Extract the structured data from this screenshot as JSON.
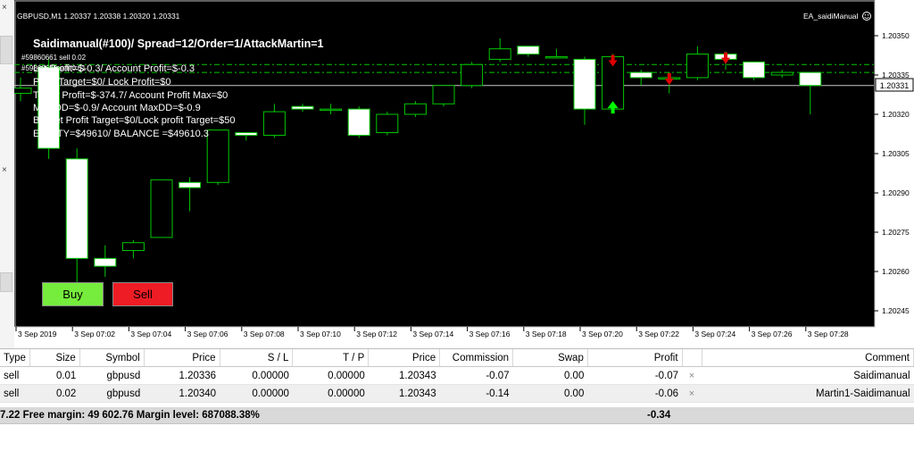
{
  "chart": {
    "header": "GBPUSD,M1  1.20337 1.20338 1.20320 1.20331",
    "ea_name": "EA_saidiManual",
    "ea_icon": "smiley-icon",
    "current_price": "1.20331",
    "price_axis": [
      "1.20350",
      "1.20335",
      "1.20320",
      "1.20305",
      "1.20290",
      "1.20275",
      "1.20260",
      "1.20245"
    ],
    "time_axis": [
      "3 Sep 2019",
      "3 Sep 07:02",
      "3 Sep 07:04",
      "3 Sep 07:06",
      "3 Sep 07:08",
      "3 Sep 07:10",
      "3 Sep 07:12",
      "3 Sep 07:14",
      "3 Sep 07:16",
      "3 Sep 07:18",
      "3 Sep 07:20",
      "3 Sep 07:22",
      "3 Sep 07:24",
      "3 Sep 07:26",
      "3 Sep 07:28"
    ],
    "colors": {
      "background": "#000000",
      "bull": "#00c800",
      "bear": "#ffffff",
      "grid_line": "#00c800",
      "buy_arrow": "#00ff00",
      "sell_arrow": "#e00000"
    },
    "candles": [
      {
        "o": 1.20328,
        "h": 1.20334,
        "l": 1.20325,
        "c": 1.2033
      },
      {
        "o": 1.20338,
        "h": 1.20341,
        "l": 1.20303,
        "c": 1.20307
      },
      {
        "o": 1.20303,
        "h": 1.20307,
        "l": 1.20255,
        "c": 1.20265
      },
      {
        "o": 1.20265,
        "h": 1.2027,
        "l": 1.20258,
        "c": 1.20262
      },
      {
        "o": 1.20268,
        "h": 1.20272,
        "l": 1.20265,
        "c": 1.20271
      },
      {
        "o": 1.20273,
        "h": 1.20295,
        "l": 1.20273,
        "c": 1.20295
      },
      {
        "o": 1.20294,
        "h": 1.20296,
        "l": 1.20283,
        "c": 1.20292
      },
      {
        "o": 1.20294,
        "h": 1.20314,
        "l": 1.20293,
        "c": 1.20314
      },
      {
        "o": 1.20313,
        "h": 1.20313,
        "l": 1.2031,
        "c": 1.20312
      },
      {
        "o": 1.20312,
        "h": 1.20324,
        "l": 1.20311,
        "c": 1.20321
      },
      {
        "o": 1.20323,
        "h": 1.20324,
        "l": 1.20321,
        "c": 1.20322
      },
      {
        "o": 1.20322,
        "h": 1.20324,
        "l": 1.2032,
        "c": 1.20322
      },
      {
        "o": 1.20322,
        "h": 1.20323,
        "l": 1.20311,
        "c": 1.20312
      },
      {
        "o": 1.20313,
        "h": 1.20321,
        "l": 1.20312,
        "c": 1.2032
      },
      {
        "o": 1.2032,
        "h": 1.20325,
        "l": 1.20319,
        "c": 1.20324
      },
      {
        "o": 1.20324,
        "h": 1.20331,
        "l": 1.20323,
        "c": 1.20331
      },
      {
        "o": 1.20331,
        "h": 1.2034,
        "l": 1.2033,
        "c": 1.20339
      },
      {
        "o": 1.20341,
        "h": 1.20349,
        "l": 1.2034,
        "c": 1.20345
      },
      {
        "o": 1.20346,
        "h": 1.20346,
        "l": 1.20342,
        "c": 1.20343
      },
      {
        "o": 1.20342,
        "h": 1.20345,
        "l": 1.20342,
        "c": 1.20342
      },
      {
        "o": 1.20341,
        "h": 1.20342,
        "l": 1.20316,
        "c": 1.20322
      },
      {
        "o": 1.20322,
        "h": 1.20343,
        "l": 1.20321,
        "c": 1.20342
      },
      {
        "o": 1.20336,
        "h": 1.20337,
        "l": 1.20331,
        "c": 1.20334
      },
      {
        "o": 1.20334,
        "h": 1.20336,
        "l": 1.20328,
        "c": 1.20334
      },
      {
        "o": 1.20334,
        "h": 1.20346,
        "l": 1.20333,
        "c": 1.20343
      },
      {
        "o": 1.20343,
        "h": 1.20344,
        "l": 1.20337,
        "c": 1.20341
      },
      {
        "o": 1.2034,
        "h": 1.2034,
        "l": 1.20333,
        "c": 1.20334
      },
      {
        "o": 1.20335,
        "h": 1.20337,
        "l": 1.20334,
        "c": 1.20336
      },
      {
        "o": 1.20336,
        "h": 1.20336,
        "l": 1.2032,
        "c": 1.20331
      }
    ],
    "h_lines": [
      1.20339,
      1.20336,
      1.20331
    ],
    "arrows": [
      {
        "index": 21,
        "dir": "buy"
      },
      {
        "index": 21,
        "dir": "sell"
      },
      {
        "index": 23,
        "dir": "sell"
      },
      {
        "index": 25,
        "dir": "sell"
      }
    ],
    "overlay": {
      "title": "Saidimanual(#100)/ Spread=12/Order=1/AttackMartin=1",
      "order_labels": [
        "#59860661 sell 0.02",
        "#59860626 sell 0.01"
      ],
      "lines": [
        "Lot Profit=$-0.3/ Account Profit=$-0.3",
        "Profit Target=$0/ Lock Profit=$0",
        "Today Profit=$-374.7/ Account Profit Max=$0",
        "Max DD=$-0.9/ Account MaxDD=$-0.9",
        "Basket Profit Target=$0/Lock profit Target=$50",
        "EQUITY=$49610/ BALANCE =$49610.3"
      ]
    },
    "buy_label": "Buy",
    "sell_label": "Sell"
  },
  "terminal": {
    "columns": [
      "Type",
      "Size",
      "Symbol",
      "Price",
      "S / L",
      "T / P",
      "Price",
      "Commission",
      "Swap",
      "Profit",
      "",
      "Comment"
    ],
    "rows": [
      {
        "type": "sell",
        "size": "0.01",
        "symbol": "gbpusd",
        "open_price": "1.20336",
        "sl": "0.00000",
        "tp": "0.00000",
        "price": "1.20343",
        "commission": "-0.07",
        "swap": "0.00",
        "profit": "-0.07",
        "close": "×",
        "comment": "Saidimanual"
      },
      {
        "type": "sell",
        "size": "0.02",
        "symbol": "gbpusd",
        "open_price": "1.20340",
        "sl": "0.00000",
        "tp": "0.00000",
        "price": "1.20343",
        "commission": "-0.14",
        "swap": "0.00",
        "profit": "-0.06",
        "close": "×",
        "comment": "Martin1-Saidimanual"
      }
    ],
    "summary": "7.22  Free margin: 49 602.76  Margin level: 687088.38%",
    "summary_profit": "-0.34"
  }
}
